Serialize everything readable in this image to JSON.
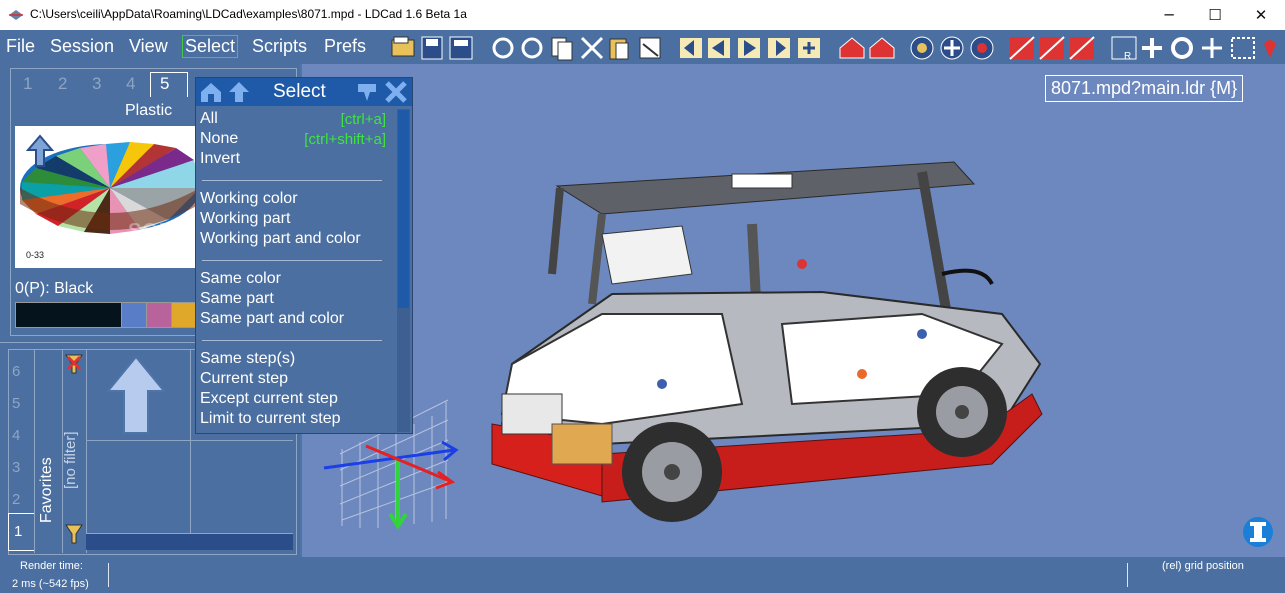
{
  "window": {
    "title": "C:\\Users\\ceili\\AppData\\Roaming\\LDCad\\examples\\8071.mpd - LDCad 1.6 Beta 1a",
    "minimize": "─",
    "maximize": "☐",
    "close": "✕"
  },
  "menu": {
    "items": [
      "File",
      "Session",
      "View",
      "Select",
      "Scripts",
      "Prefs"
    ],
    "active": "Select"
  },
  "colors": {
    "accent_green": "#3fe33f",
    "panel_blue": "#4a6fa0",
    "viewport_blue": "#6d88bf",
    "header_blue": "#1f5aa8"
  },
  "color_panel": {
    "tabs": [
      "1",
      "2",
      "3",
      "4",
      "5"
    ],
    "active_tab": "5",
    "group_label": "Plastic",
    "range_label": "0-33",
    "current_color": "0(P): Black",
    "swatches": [
      "#05131d",
      "#5a7dc7",
      "#b9639c",
      "#e0a82b"
    ]
  },
  "parts_panel": {
    "tabs": [
      "1",
      "2",
      "3",
      "4",
      "5",
      "6"
    ],
    "active_tab": "1",
    "group_label": "Favorites",
    "filter_label": "[no filter]"
  },
  "select_menu": {
    "title": "Select",
    "sections": [
      [
        {
          "label": "All",
          "shortcut": "[ctrl+a]"
        },
        {
          "label": "None",
          "shortcut": "[ctrl+shift+a]"
        },
        {
          "label": "Invert",
          "shortcut": ""
        }
      ],
      [
        {
          "label": "Working color",
          "shortcut": ""
        },
        {
          "label": "Working part",
          "shortcut": ""
        },
        {
          "label": "Working part and color",
          "shortcut": ""
        }
      ],
      [
        {
          "label": "Same color",
          "shortcut": ""
        },
        {
          "label": "Same part",
          "shortcut": ""
        },
        {
          "label": "Same part and color",
          "shortcut": ""
        }
      ],
      [
        {
          "label": "Same step(s)",
          "shortcut": ""
        },
        {
          "label": "Current step",
          "shortcut": ""
        },
        {
          "label": "Except current step",
          "shortcut": ""
        },
        {
          "label": "Limit to current step",
          "shortcut": ""
        }
      ]
    ]
  },
  "viewport": {
    "model_label": "8071.mpd?main.ldr {M}",
    "info_icon": "info-icon",
    "watermark": "SOFTPEDIA"
  },
  "status": {
    "render_label": "Render time:",
    "render_value": "2 ms (~542 fps)",
    "grid_label": "(rel) grid position"
  }
}
